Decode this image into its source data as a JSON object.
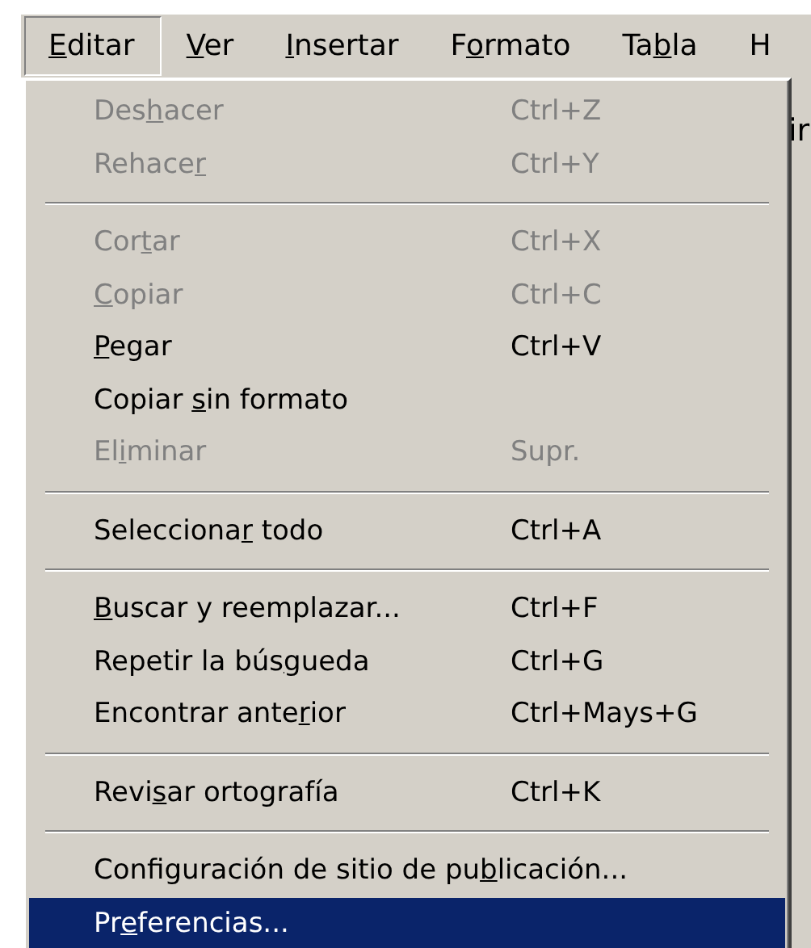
{
  "menubar": [
    {
      "key": "E",
      "after": "ditar",
      "selected": true
    },
    {
      "key": "V",
      "after": "er",
      "selected": false
    },
    {
      "key": "I",
      "after": "nsertar",
      "selected": false
    },
    {
      "before": "F",
      "key": "o",
      "after": "rmato",
      "selected": false
    },
    {
      "before": "Ta",
      "key": "b",
      "after": "la",
      "selected": false
    },
    {
      "before": "H",
      "selected": false
    }
  ],
  "background_fragment": "ir",
  "menu": [
    {
      "kind": "item",
      "before": "Des",
      "key": "h",
      "after": "acer",
      "shortcut": "Ctrl+Z",
      "disabled": true,
      "selected": false
    },
    {
      "kind": "item",
      "before": "Rehace",
      "key": "r",
      "shortcut": "Ctrl+Y",
      "disabled": true,
      "selected": false
    },
    {
      "kind": "separator"
    },
    {
      "kind": "item",
      "before": "Cor",
      "key": "t",
      "after": "ar",
      "shortcut": "Ctrl+X",
      "disabled": true,
      "selected": false
    },
    {
      "kind": "item",
      "key": "C",
      "after": "opiar",
      "shortcut": "Ctrl+C",
      "disabled": true,
      "selected": false
    },
    {
      "kind": "item",
      "key": "P",
      "after": "egar",
      "shortcut": "Ctrl+V",
      "disabled": false,
      "selected": false
    },
    {
      "kind": "item",
      "before": "Copiar ",
      "key": "s",
      "after": "in formato",
      "disabled": false,
      "selected": false
    },
    {
      "kind": "item",
      "before": "El",
      "key": "i",
      "after": "minar",
      "shortcut": "Supr.",
      "disabled": true,
      "selected": false
    },
    {
      "kind": "separator"
    },
    {
      "kind": "item",
      "before": "Selecciona",
      "key": "r",
      "after": " todo",
      "shortcut": "Ctrl+A",
      "disabled": false,
      "selected": false
    },
    {
      "kind": "separator"
    },
    {
      "kind": "item",
      "key": "B",
      "after": "uscar y reemplazar...",
      "shortcut": "Ctrl+F",
      "disabled": false,
      "selected": false
    },
    {
      "kind": "item",
      "before": "Repetir la bús",
      "key": "g",
      "after": "ueda",
      "shortcut": "Ctrl+G",
      "disabled": false,
      "selected": false
    },
    {
      "kind": "item",
      "before": "Encontrar ante",
      "key": "r",
      "after": "ior",
      "shortcut": "Ctrl+Mays+G",
      "disabled": false,
      "selected": false
    },
    {
      "kind": "separator"
    },
    {
      "kind": "item",
      "before": "Revi",
      "key": "s",
      "after": "ar ortografía",
      "shortcut": "Ctrl+K",
      "disabled": false,
      "selected": false
    },
    {
      "kind": "separator"
    },
    {
      "kind": "item",
      "before": "Configuración de sitio de pu",
      "key": "b",
      "after": "licación...",
      "disabled": false,
      "selected": false
    },
    {
      "kind": "item",
      "before": "Pr",
      "key": "e",
      "after": "ferencias...",
      "disabled": false,
      "selected": true
    }
  ]
}
